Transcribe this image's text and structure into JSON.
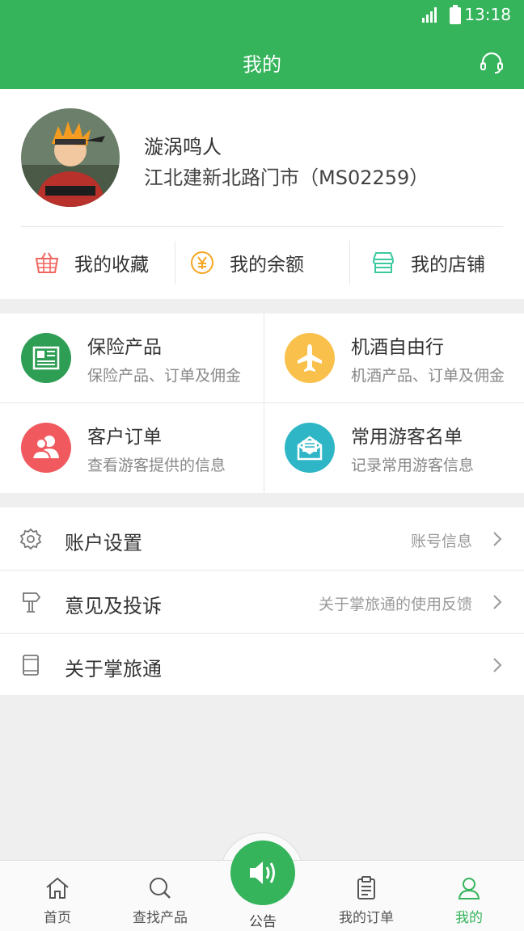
{
  "status_bar": {
    "time": "13:18",
    "signal_icon": "signal-icon",
    "battery_icon": "battery-icon"
  },
  "header": {
    "title": "我的",
    "support_icon": "headset-icon"
  },
  "profile": {
    "name": "漩涡鸣人",
    "store": "江北建新北路门市（MS02259）",
    "quick_links": [
      {
        "label": "我的收藏",
        "icon": "basket-icon",
        "color": "#f0655e"
      },
      {
        "label": "我的余额",
        "icon": "yen-coin-icon",
        "color": "#f5a623"
      },
      {
        "label": "我的店铺",
        "icon": "shop-icon",
        "color": "#3cc9a0"
      }
    ]
  },
  "services": [
    {
      "title": "保险产品",
      "subtitle": "保险产品、订单及佣金",
      "icon": "newspaper-icon",
      "color": "#2f9e55"
    },
    {
      "title": "机酒自由行",
      "subtitle": "机酒产品、订单及佣金",
      "icon": "airplane-icon",
      "color": "#f9c04b"
    },
    {
      "title": "客户订单",
      "subtitle": "查看游客提供的信息",
      "icon": "users-icon",
      "color": "#f05a5f"
    },
    {
      "title": "常用游客名单",
      "subtitle": "记录常用游客信息",
      "icon": "envelope-icon",
      "color": "#2fb6c6"
    }
  ],
  "menu": [
    {
      "label": "账户设置",
      "hint": "账号信息",
      "icon": "gear-icon"
    },
    {
      "label": "意见及投诉",
      "hint": "关于掌旅通的使用反馈",
      "icon": "signpost-icon"
    },
    {
      "label": "关于掌旅通",
      "hint": "",
      "icon": "tablet-icon"
    }
  ],
  "tabbar": {
    "tabs": [
      {
        "label": "首页",
        "icon": "home-icon"
      },
      {
        "label": "查找产品",
        "icon": "search-icon"
      },
      {
        "label": "公告",
        "icon": "speaker-icon"
      },
      {
        "label": "我的订单",
        "icon": "clipboard-icon"
      },
      {
        "label": "我的",
        "icon": "user-icon"
      }
    ],
    "active_index": 4,
    "accent": "#35b45c"
  }
}
